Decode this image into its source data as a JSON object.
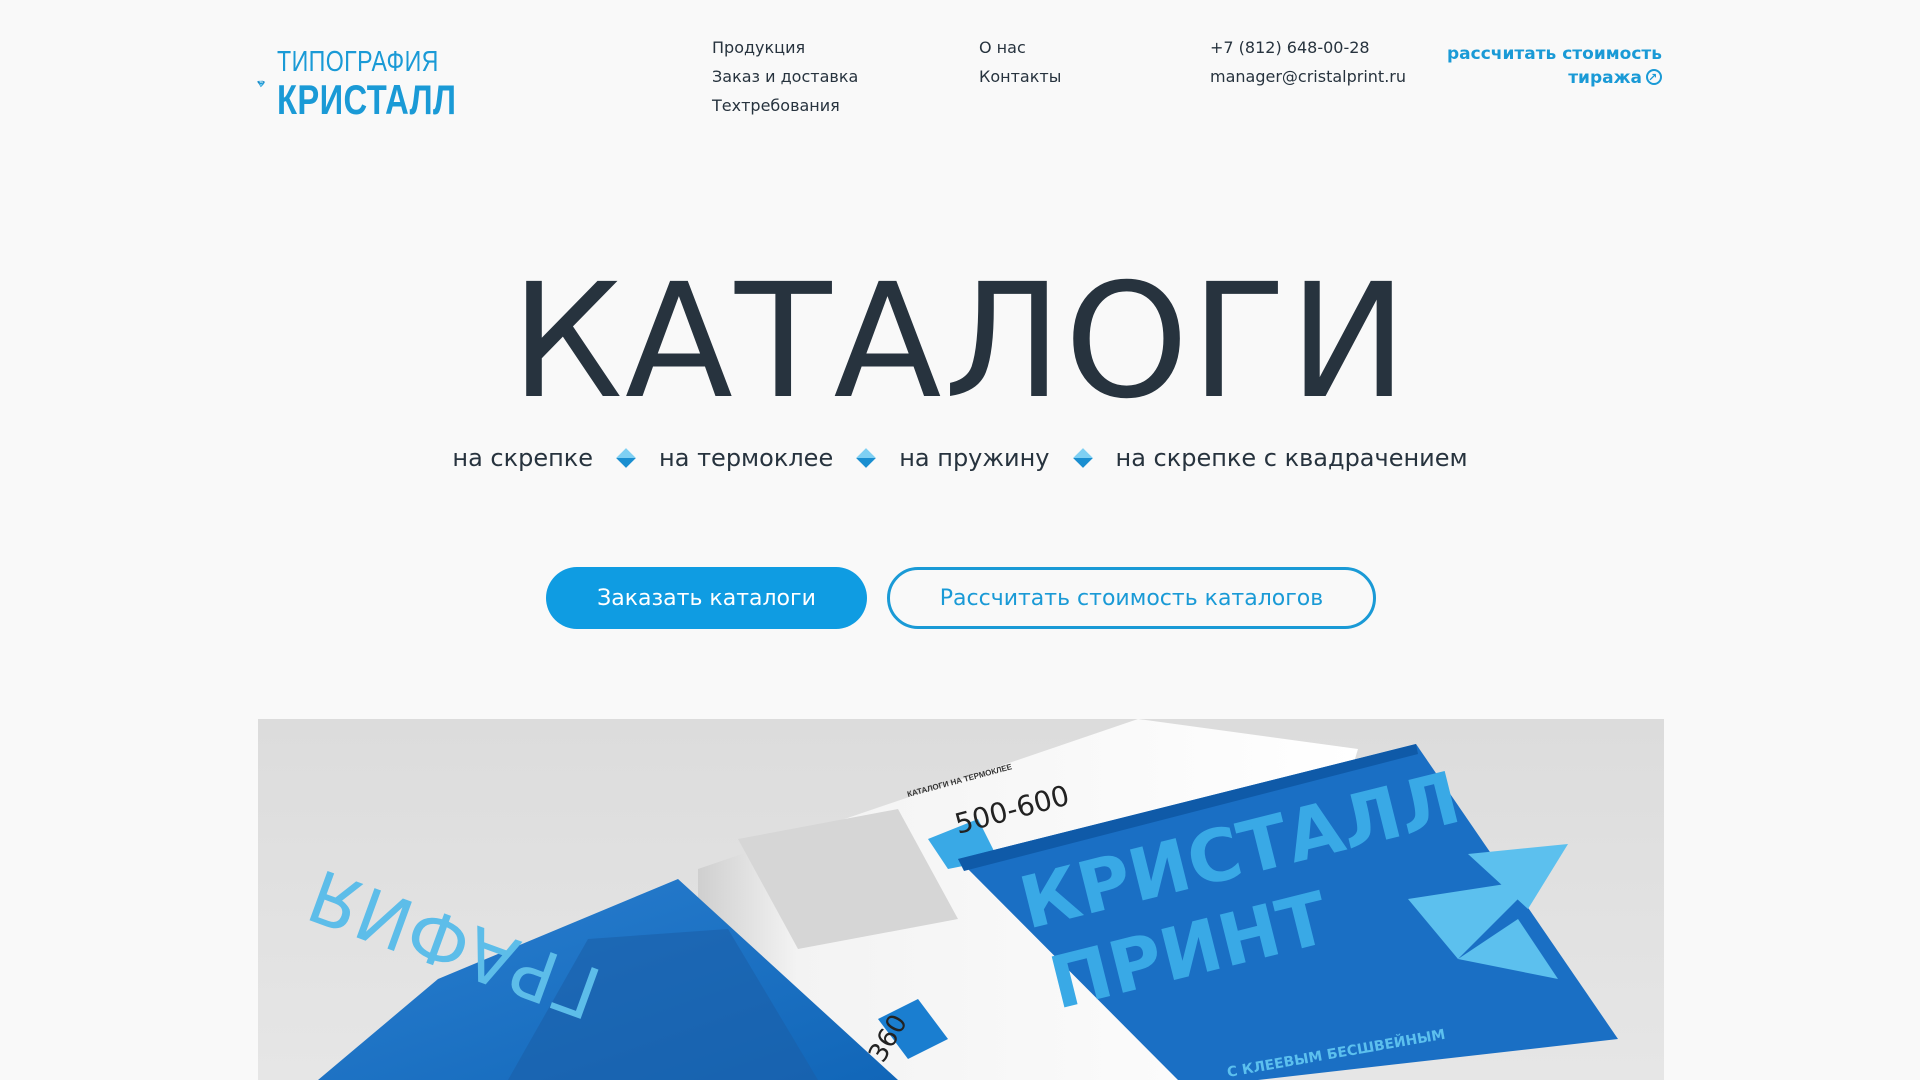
{
  "logo": {
    "line1": "ТИПОГРАФИЯ",
    "line2": "КРИСТАЛЛ"
  },
  "nav": {
    "col1": [
      "Продукция",
      "Заказ и доставка",
      "Техтребования"
    ],
    "col2": [
      "О нас",
      "Контакты"
    ],
    "contacts": {
      "phone": "+7 (812) 648-00-28",
      "email": "manager@cristalprint.ru"
    }
  },
  "calc_link": {
    "line1": "рассчитать стоимость",
    "line2": "тиража"
  },
  "hero": {
    "title": "КАТАЛОГИ",
    "types": [
      "на скрепке",
      "на термоклее",
      "на пружину",
      "на скрепке с квадрачением"
    ],
    "order_button": "Заказать каталоги",
    "calc_button": "Рассчитать стоимость каталогов"
  },
  "image": {
    "left_page_text": "КАТАЛОГИ НА ТЕРМОКЛЕЕ",
    "left_number": "500-600",
    "left_number2": "360",
    "left_book_text": "ГРАФИЯ",
    "cover_line1": "КРИСТАЛЛ",
    "cover_line2": "ПРИНТ",
    "cover_bottom": "С КЛЕЕВЫМ БЕСШВЕЙНЫМ"
  },
  "colors": {
    "accent": "#1a9ad6",
    "button": "#0f9ce2",
    "text": "#27333e",
    "background": "#f9f9f9"
  }
}
